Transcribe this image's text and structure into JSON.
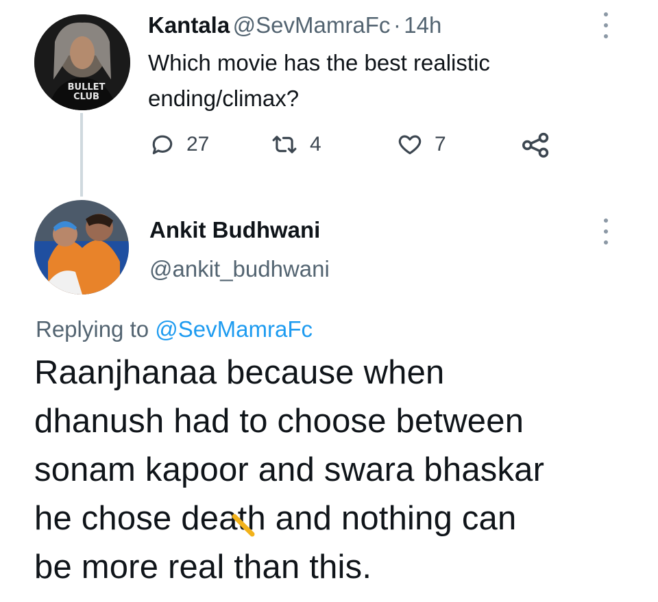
{
  "tweet": {
    "author_name": "Kantala",
    "author_handle": "@SevMamraFc",
    "separator": "·",
    "timestamp": "14h",
    "text_line1": "Which movie has the best realistic",
    "text_line2": "ending/climax?",
    "avatar_text_line1": "BULLET",
    "avatar_text_line2": "CLUB",
    "replies_count": "27",
    "retweets_count": "4",
    "likes_count": "7",
    "icons": [
      "reply-icon",
      "retweet-icon",
      "like-icon",
      "share-icon",
      "more-icon"
    ]
  },
  "reply": {
    "author_name": "Ankit Budhwani",
    "author_handle": "@ankit_budhwani",
    "replying_prefix": "Replying to",
    "replying_to": "@SevMamraFc",
    "text_lines": [
      "Raanjhanaa because when",
      "dhanush had to choose between",
      "sonam kapoor and swara bhaskar",
      "he chose death and nothing can",
      "be more real than this."
    ]
  },
  "colors": {
    "link": "#1d9bf0",
    "muted": "#536471",
    "text": "#0f1419",
    "thread_line": "#cfd9de"
  }
}
